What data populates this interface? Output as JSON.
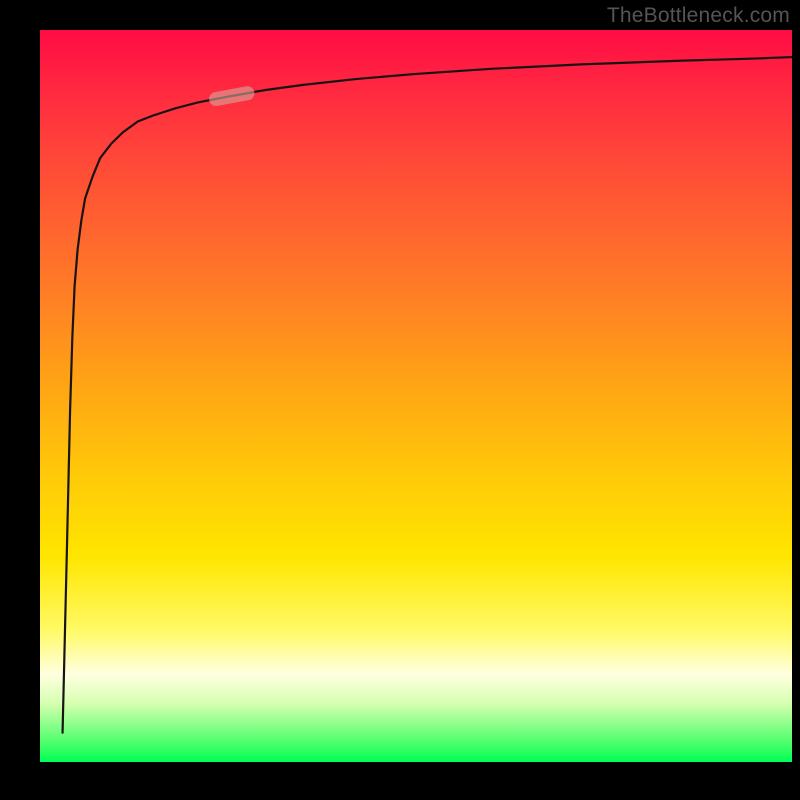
{
  "watermark": "TheBottleneck.com",
  "colors": {
    "frame": "#000000",
    "watermark_text": "#555555",
    "gradient_stops": [
      "#ff0c44",
      "#ff2f3f",
      "#ff5534",
      "#ff7b27",
      "#ffa315",
      "#ffc709",
      "#ffe600",
      "#fffa66",
      "#ffffe0",
      "#d6ffb0",
      "#49ff6a",
      "#00ff55"
    ],
    "curve_stroke": "#181414",
    "marker_fill": "#d9a69a",
    "marker_fill_alpha": 0.6
  },
  "chart_data": {
    "type": "line",
    "title": "",
    "xlabel": "",
    "ylabel": "",
    "xlim": [
      0,
      100
    ],
    "ylim": [
      0,
      100
    ],
    "series": [
      {
        "name": "bottleneck-curve",
        "x": [
          3.0,
          3.6,
          4.0,
          4.3,
          4.6,
          5.0,
          5.5,
          6.0,
          7.0,
          8.0,
          9.5,
          11,
          13,
          15,
          18,
          21,
          25,
          30,
          35,
          42,
          50,
          60,
          72,
          85,
          95,
          100
        ],
        "y": [
          4.0,
          30,
          48,
          58,
          65,
          70,
          74,
          77,
          80,
          82.5,
          84.5,
          86,
          87.5,
          88.3,
          89.3,
          90.1,
          90.9,
          91.8,
          92.5,
          93.3,
          94.0,
          94.7,
          95.3,
          95.8,
          96.1,
          96.3
        ]
      }
    ],
    "marker": {
      "x_range": [
        22.5,
        28.5
      ],
      "y_range": [
        84.5,
        86.8
      ],
      "note": "rounded capsule marker on curve"
    },
    "background_gradient": {
      "orientation": "vertical",
      "top": "red-pink",
      "middle": "orange-yellow",
      "bottom": "green"
    }
  }
}
